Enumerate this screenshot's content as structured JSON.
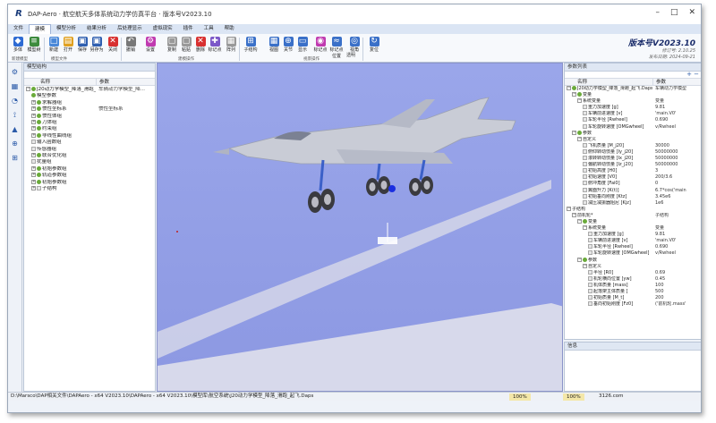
{
  "window": {
    "title": "DAP-Aero · 航空航天多体系统动力学仿真平台 · 版本号V2023.10",
    "controls": [
      "–",
      "□",
      "✕"
    ]
  },
  "menu": {
    "items": [
      "文件",
      "建模",
      "模型分析",
      "结果分析",
      "后处理显示",
      "虚拟现实",
      "插件",
      "工具",
      "帮助"
    ],
    "active_index": 1
  },
  "ribbon": {
    "buttons": [
      {
        "label": "多体",
        "color": "#2e6bd3",
        "glyph": "◆"
      },
      {
        "label": "模型树",
        "color": "#3d8b3d",
        "glyph": "≡"
      },
      {
        "label": "新建",
        "color": "#4a88d8",
        "glyph": "□"
      },
      {
        "label": "打开",
        "color": "#e0a020",
        "glyph": "▤"
      },
      {
        "label": "保存",
        "color": "#2f5fb0",
        "glyph": "▣"
      },
      {
        "label": "另存为",
        "color": "#2f5fb0",
        "glyph": "▣"
      },
      {
        "label": "关闭",
        "color": "#d83030",
        "glyph": "✕"
      },
      {
        "label": "撤销",
        "color": "#777777",
        "glyph": "↶"
      },
      {
        "label": "设置",
        "color": "#c03ab0",
        "glyph": "⚙"
      },
      {
        "label": "复制",
        "color": "#999999",
        "glyph": "▢"
      },
      {
        "label": "粘贴",
        "color": "#999999",
        "glyph": "▢"
      },
      {
        "label": "删除",
        "color": "#d83030",
        "glyph": "✕"
      },
      {
        "label": "标记点",
        "color": "#7b58c8",
        "glyph": "✚"
      },
      {
        "label": "阵列",
        "color": "#999999",
        "glyph": "▦"
      },
      {
        "label": "子结构",
        "color": "#3a70c8",
        "glyph": "⊞"
      },
      {
        "label": "视图",
        "color": "#3a70c8",
        "glyph": "▦"
      },
      {
        "label": "关节",
        "color": "#3a70c8",
        "glyph": "⊕"
      },
      {
        "label": "显示",
        "color": "#3a70c8",
        "glyph": "▭"
      },
      {
        "label": "标记点",
        "color": "#c03ab0",
        "glyph": "◉"
      },
      {
        "label": "标记点位置",
        "color": "#3a70c8",
        "glyph": "≈"
      },
      {
        "label": "视角",
        "color": "#3a70c8",
        "glyph": "◎"
      },
      {
        "label": "复位",
        "color": "#3a70c8",
        "glyph": "↻"
      }
    ],
    "groups": [
      "新建模型",
      "模型文件",
      "建模操作",
      "视景操作"
    ],
    "transparency_label": "透明"
  },
  "version": {
    "title": "版本号V2023.10",
    "line1": "修订号: 2.10.25",
    "line2": "发布日期: 2024-09-21"
  },
  "left_tools": [
    "⚙",
    "▦",
    "◔",
    "⟟",
    "▲",
    "⊕",
    "⊞"
  ],
  "model_tree": {
    "title": "模型结构",
    "col_name": "名称",
    "col_param": "参数",
    "rows": [
      {
        "indent": 0,
        "pm": "−",
        "icon": "green",
        "name": "J20动力学模型_降落_滑跑_起飞.Daps",
        "param": "车辆动力学模型_降..."
      },
      {
        "indent": 1,
        "pm": "",
        "icon": "green",
        "name": "模型参数",
        "param": ""
      },
      {
        "indent": 1,
        "pm": "+",
        "icon": "green",
        "name": "求解器组",
        "param": ""
      },
      {
        "indent": 1,
        "pm": "+",
        "icon": "green",
        "name": "惯性坐标系",
        "param": "惯性坐标系"
      },
      {
        "indent": 1,
        "pm": "+",
        "icon": "green",
        "name": "惯性体组",
        "param": ""
      },
      {
        "indent": 1,
        "pm": "+",
        "icon": "green",
        "name": "刀体组",
        "param": ""
      },
      {
        "indent": 1,
        "pm": "+",
        "icon": "green",
        "name": "约束组",
        "param": ""
      },
      {
        "indent": 1,
        "pm": "+",
        "icon": "green",
        "name": "非线性曲线组",
        "param": ""
      },
      {
        "indent": 1,
        "pm": "",
        "icon": "file",
        "name": "输入函数组",
        "param": ""
      },
      {
        "indent": 1,
        "pm": "",
        "icon": "file",
        "name": "传感器组",
        "param": ""
      },
      {
        "indent": 1,
        "pm": "+",
        "icon": "green",
        "name": "联合优化组",
        "param": ""
      },
      {
        "indent": 1,
        "pm": "",
        "icon": "file",
        "name": "扰量组",
        "param": ""
      },
      {
        "indent": 1,
        "pm": "+",
        "icon": "green",
        "name": "初始参数组",
        "param": ""
      },
      {
        "indent": 1,
        "pm": "+",
        "icon": "green",
        "name": "轨道参数组",
        "param": ""
      },
      {
        "indent": 1,
        "pm": "+",
        "icon": "green",
        "name": "初始参数组",
        "param": ""
      },
      {
        "indent": 1,
        "pm": "+",
        "icon": "file",
        "name": "子结构",
        "param": ""
      }
    ]
  },
  "param_list": {
    "title": "参数列表",
    "col_name": "名称",
    "col_param": "参数",
    "rows": [
      {
        "indent": 0,
        "pm": "−",
        "icon": "green",
        "name": "J20动力学模型_降落_滑跑_起飞.Daps",
        "param": "车辆动力学模型"
      },
      {
        "indent": 1,
        "pm": "−",
        "icon": "green",
        "name": "变量",
        "param": ""
      },
      {
        "indent": 2,
        "pm": "−",
        "icon": "none",
        "name": "系统变量",
        "param": "变量"
      },
      {
        "indent": 3,
        "pm": "",
        "icon": "file",
        "name": "重力加速度 [g]",
        "param": "9.81"
      },
      {
        "indent": 3,
        "pm": "",
        "icon": "file",
        "name": "车辆前进速度 [v]",
        "param": "'main.V0'"
      },
      {
        "indent": 3,
        "pm": "",
        "icon": "file",
        "name": "车轮半径 [Rwheel]",
        "param": "0.690"
      },
      {
        "indent": 3,
        "pm": "",
        "icon": "file",
        "name": "车轮旋转速度 [OMGwheel]",
        "param": "v/Rwheel"
      },
      {
        "indent": 1,
        "pm": "−",
        "icon": "green",
        "name": "参数",
        "param": ""
      },
      {
        "indent": 2,
        "pm": "−",
        "icon": "none",
        "name": "自定义",
        "param": ""
      },
      {
        "indent": 3,
        "pm": "",
        "icon": "file",
        "name": "飞机质量 [M_j20]",
        "param": "30000"
      },
      {
        "indent": 3,
        "pm": "",
        "icon": "file",
        "name": "俯仰转动惯量 [Iy_j20]",
        "param": "50000000"
      },
      {
        "indent": 3,
        "pm": "",
        "icon": "file",
        "name": "滚转转动惯量 [Ix_j20]",
        "param": "50000000"
      },
      {
        "indent": 3,
        "pm": "",
        "icon": "file",
        "name": "偏航转动惯量 [Iz_j20]",
        "param": "50000000"
      },
      {
        "indent": 3,
        "pm": "",
        "icon": "file",
        "name": "初始高度 [H0]",
        "param": "3"
      },
      {
        "indent": 3,
        "pm": "",
        "icon": "file",
        "name": "初始速度 [V0]",
        "param": "200/3.6"
      },
      {
        "indent": 3,
        "pm": "",
        "icon": "file",
        "name": "俯冲角度 [Fai0]",
        "param": "0"
      },
      {
        "indent": 3,
        "pm": "",
        "icon": "file",
        "name": "翼面升力 [K(t)]",
        "param": "6.7*cos('main"
      },
      {
        "indent": 3,
        "pm": "",
        "icon": "file",
        "name": "初始垂向刚度 [Ktz]",
        "param": "3.45e6"
      },
      {
        "indent": 3,
        "pm": "",
        "icon": "file",
        "name": "减压减振器阻尼 [Kjz]",
        "param": "1e6"
      },
      {
        "indent": 0,
        "pm": "−",
        "icon": "none",
        "name": "子结构",
        "param": ""
      },
      {
        "indent": 1,
        "pm": "−",
        "icon": "none",
        "name": "前机轮*",
        "param": "子结构"
      },
      {
        "indent": 2,
        "pm": "−",
        "icon": "green",
        "name": "变量",
        "param": ""
      },
      {
        "indent": 3,
        "pm": "−",
        "icon": "none",
        "name": "系统变量",
        "param": "变量"
      },
      {
        "indent": 4,
        "pm": "",
        "icon": "file",
        "name": "重力加速度 [g]",
        "param": "9.81"
      },
      {
        "indent": 4,
        "pm": "",
        "icon": "file",
        "name": "车辆前进速度 [v]",
        "param": "'main.V0'"
      },
      {
        "indent": 4,
        "pm": "",
        "icon": "file",
        "name": "车轮半径 [Rwheel]",
        "param": "0.690"
      },
      {
        "indent": 4,
        "pm": "",
        "icon": "file",
        "name": "车轮旋转速度 [OMGwheel]",
        "param": "v/Rwheel"
      },
      {
        "indent": 2,
        "pm": "−",
        "icon": "green",
        "name": "参数",
        "param": ""
      },
      {
        "indent": 3,
        "pm": "−",
        "icon": "none",
        "name": "自定义",
        "param": ""
      },
      {
        "indent": 4,
        "pm": "",
        "icon": "file",
        "name": "半径 [R0]",
        "param": "0.69"
      },
      {
        "indent": 4,
        "pm": "",
        "icon": "file",
        "name": "机轮横向位置 [yw]",
        "param": "0.45"
      },
      {
        "indent": 4,
        "pm": "",
        "icon": "file",
        "name": "机体质量 [mass]",
        "param": "100"
      },
      {
        "indent": 4,
        "pm": "",
        "icon": "file",
        "name": "起落架主体质量 [",
        "param": "500"
      },
      {
        "indent": 4,
        "pm": "",
        "icon": "file",
        "name": "初始质量 [M_t]",
        "param": "200"
      },
      {
        "indent": 4,
        "pm": "",
        "icon": "file",
        "name": "垂向初始刚度 [Fz0]",
        "param": "('前机轮.mass'"
      }
    ]
  },
  "info_panel": {
    "title": "信息"
  },
  "status": {
    "path": "D:\\Marsco\\DAP相关文件\\DAPAero - x64 V2023.10\\DAPAero - x64 V2023.10\\模型库\\航空系统\\J20动力学模型_降落_滑跑_起飞.Daps",
    "zoom1": "100%",
    "zoom2": "100%",
    "site": "3126.com"
  }
}
